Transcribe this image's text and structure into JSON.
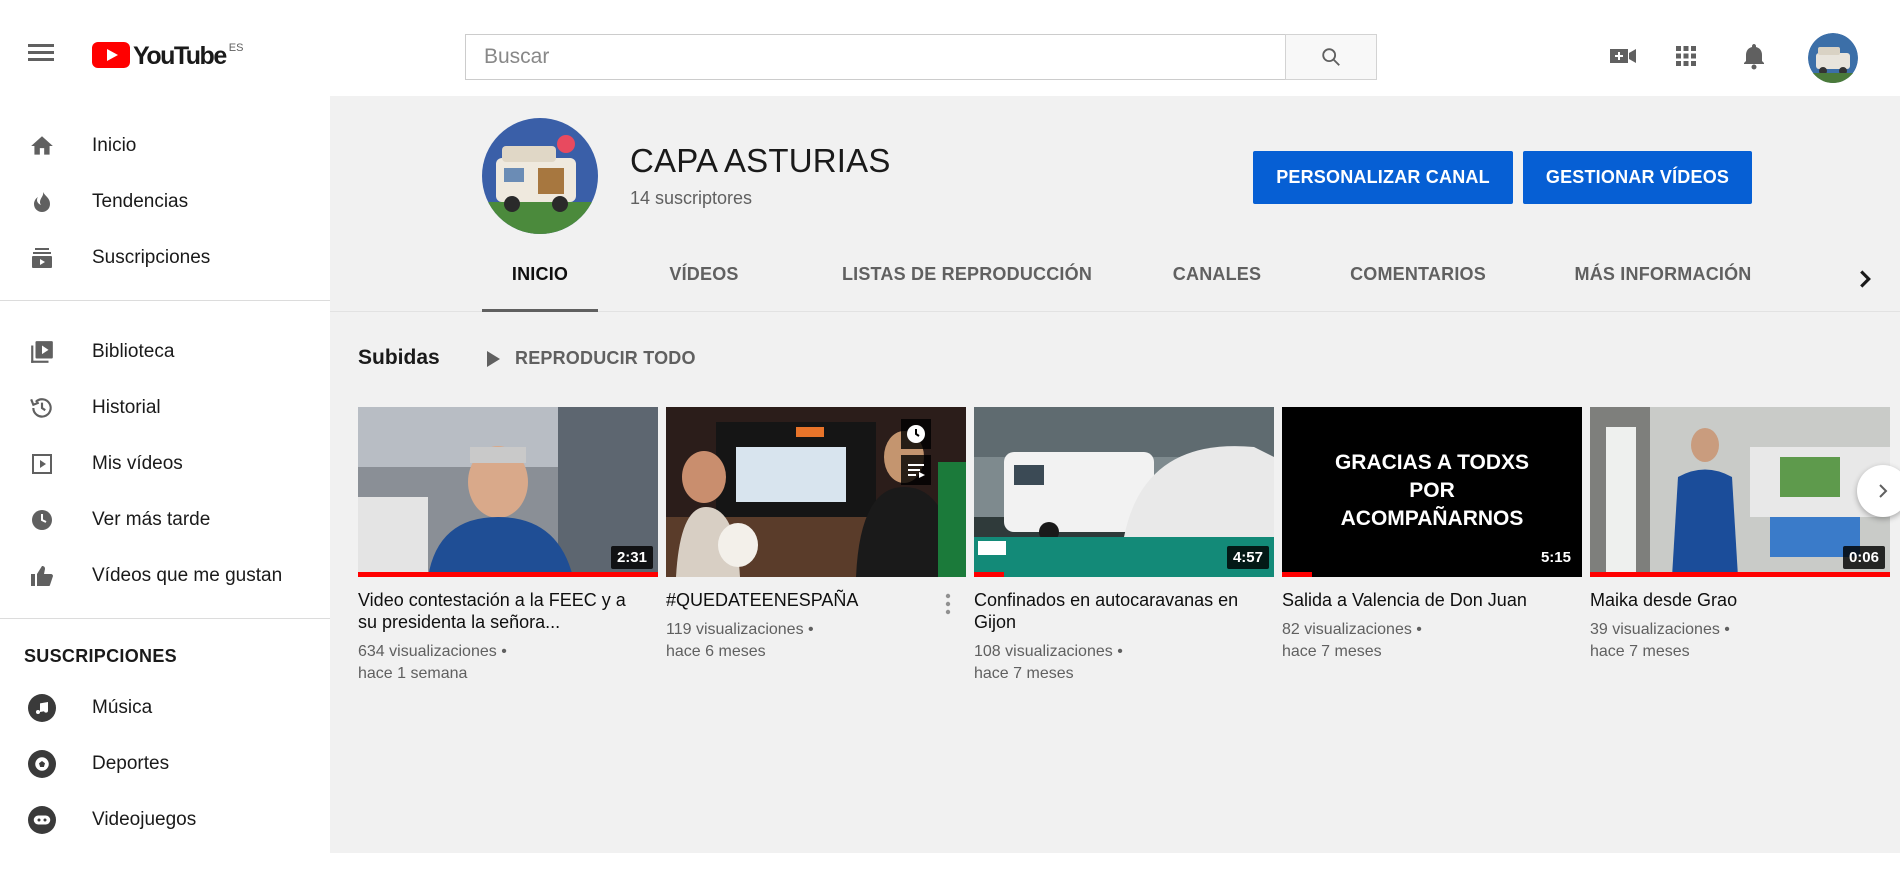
{
  "topbar": {
    "menu_icon": "hamburger-menu-icon",
    "logo_text": "YouTube",
    "logo_region": "ES",
    "search_placeholder": "Buscar",
    "search_icon": "search-icon",
    "icons": [
      "video-camera-create-icon",
      "apps-grid-icon",
      "notifications-bell-icon"
    ],
    "colors": {
      "brand": "#ff0000",
      "accent": "#065fd4"
    }
  },
  "sidebar": {
    "main": [
      {
        "label": "Inicio",
        "icon": "home-icon"
      },
      {
        "label": "Tendencias",
        "icon": "flame-icon"
      },
      {
        "label": "Suscripciones",
        "icon": "subscriptions-icon"
      }
    ],
    "library": [
      {
        "label": "Biblioteca",
        "icon": "library-icon"
      },
      {
        "label": "Historial",
        "icon": "history-icon"
      },
      {
        "label": "Mis vídeos",
        "icon": "my-videos-icon"
      },
      {
        "label": "Ver más tarde",
        "icon": "clock-icon"
      },
      {
        "label": "Vídeos que me gustan",
        "icon": "thumbs-up-icon"
      }
    ],
    "subscriptions_header": "SUSCRIPCIONES",
    "subscriptions": [
      {
        "label": "Música",
        "icon": "music-icon"
      },
      {
        "label": "Deportes",
        "icon": "sports-icon"
      },
      {
        "label": "Videojuegos",
        "icon": "gaming-icon"
      }
    ]
  },
  "channel": {
    "name": "CAPA ASTURIAS",
    "subscribers": "14 suscriptores",
    "customize_label": "PERSONALIZAR CANAL",
    "manage_label": "GESTIONAR VÍDEOS",
    "tabs": [
      {
        "label": "INICIO",
        "active": true
      },
      {
        "label": "VÍDEOS",
        "active": false
      },
      {
        "label": "LISTAS DE REPRODUCCIÓN",
        "active": false
      },
      {
        "label": "CANALES",
        "active": false
      },
      {
        "label": "COMENTARIOS",
        "active": false
      },
      {
        "label": "MÁS INFORMACIÓN",
        "active": false
      }
    ]
  },
  "shelf": {
    "title": "Subidas",
    "play_all_label": "REPRODUCIR TODO",
    "videos": [
      {
        "title": "Video contestación a la FEEC y a su presidenta la señora...",
        "views": "634 visualizaciones •",
        "age": "hace 1 semana",
        "duration": "2:31",
        "watched_fraction": 1.0
      },
      {
        "title": "#QUEDATEENESPAÑA",
        "views": "119 visualizaciones •",
        "age": "hace 6 meses",
        "duration": "",
        "watched_fraction": 0
      },
      {
        "title": "Confinados en autocaravanas en Gijon",
        "views": "108 visualizaciones •",
        "age": "hace 7 meses",
        "duration": "4:57",
        "watched_fraction": 0.1
      },
      {
        "title": "Salida a Valencia de Don Juan",
        "views": "82 visualizaciones •",
        "age": "hace 7 meses",
        "duration": "5:15",
        "watched_fraction": 0.1,
        "thumb_text": [
          "GRACIAS A TODXS",
          "POR",
          "ACOMPAÑARNOS"
        ]
      },
      {
        "title": "Maika desde Grao",
        "views": "39 visualizaciones •",
        "age": "hace 7 meses",
        "duration": "0:06",
        "watched_fraction": 1.0
      }
    ]
  }
}
